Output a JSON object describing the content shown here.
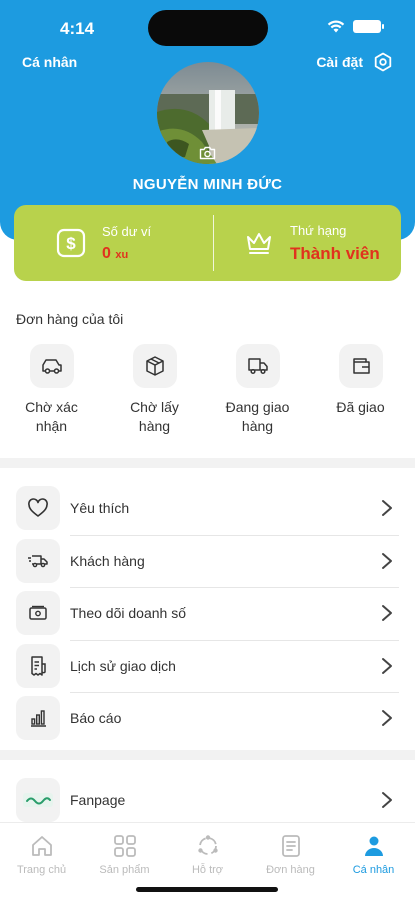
{
  "status_bar": {
    "time": "4:14"
  },
  "header": {
    "left_label": "Cá nhân",
    "settings_label": "Cài đặt",
    "user_name": "NGUYỄN MINH ĐỨC"
  },
  "wallet": {
    "balance_label": "Số dư ví",
    "balance_value": "0",
    "balance_unit": "xu",
    "rank_label": "Thứ hạng",
    "rank_value": "Thành viên"
  },
  "orders": {
    "title": "Đơn hàng của tôi",
    "items": [
      {
        "label": "Chờ xác nhận",
        "icon": "car-icon"
      },
      {
        "label": "Chờ lấy hàng",
        "icon": "box-icon"
      },
      {
        "label": "Đang giao hàng",
        "icon": "delivery-truck-icon"
      },
      {
        "label": "Đã giao",
        "icon": "wallet-check-icon"
      }
    ]
  },
  "menu": {
    "items": [
      {
        "label": "Yêu thích",
        "icon": "heart-icon"
      },
      {
        "label": "Khách hàng",
        "icon": "fast-truck-icon"
      },
      {
        "label": "Theo dõi doanh số",
        "icon": "money-icon"
      },
      {
        "label": "Lịch sử giao dịch",
        "icon": "receipt-icon"
      },
      {
        "label": "Báo cáo",
        "icon": "bar-chart-icon"
      }
    ],
    "fanpage_label": "Fanpage"
  },
  "tabbar": {
    "items": [
      {
        "label": "Trang chủ",
        "icon": "home-icon"
      },
      {
        "label": "Sản phẩm",
        "icon": "grid-icon"
      },
      {
        "label": "Hỗ trợ",
        "icon": "support-icon"
      },
      {
        "label": "Đơn hàng",
        "icon": "document-icon"
      },
      {
        "label": "Cá nhân",
        "icon": "person-icon"
      }
    ],
    "active_index": 4
  },
  "colors": {
    "primary": "#1d9be0",
    "card": "#b8d24c",
    "accent_red": "#e0321e"
  }
}
